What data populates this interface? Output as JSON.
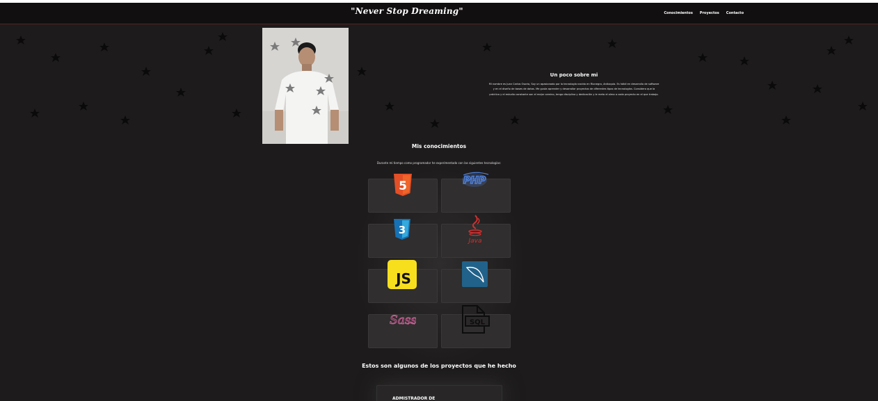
{
  "header": {
    "brand": "\"Never Stop Dreaming\"",
    "nav": [
      "Conocimientos",
      "Proyectos",
      "Contacto"
    ]
  },
  "about": {
    "title": "Un poco sobre mi",
    "text": "Mi nombre es Juan Carlos Osorio, Soy un apasionado por la tecnología nacido en Rionegro, Antioquia. Es hábil en desarrollo de software y en el diseño de bases de datos. Me gusta aprender y desarrollar proyectos de diferentes tipos de tecnologías. Considero que la práctica y el estudio constante son el mejor camino, tengo disciplina y dedicación y le meto el alma a cada proyecto en el que trabajo."
  },
  "skills": {
    "title": "Mis conocimientos",
    "subtitle": "Durante mi tiempo como programador he experimentado con las siguientes tecnologías:",
    "items": [
      "HTML5",
      "PHP",
      "CSS3",
      "Java",
      "JS",
      "MySQL",
      "Sass",
      "SQL"
    ]
  },
  "projects": {
    "title": "Estos son algunos de los proyectos que he hecho",
    "first_card": "ADMISTRADOR DE"
  },
  "colors": {
    "background": "#1d1b1b",
    "navbar": "#110f0f",
    "card": "#302e2e",
    "html5": "#e34f26",
    "css3": "#1572b6",
    "js": "#f7df1e",
    "php": "#4f80d8",
    "java": "#d32f2f",
    "mysql": "#21628a",
    "sass": "#c96196"
  }
}
